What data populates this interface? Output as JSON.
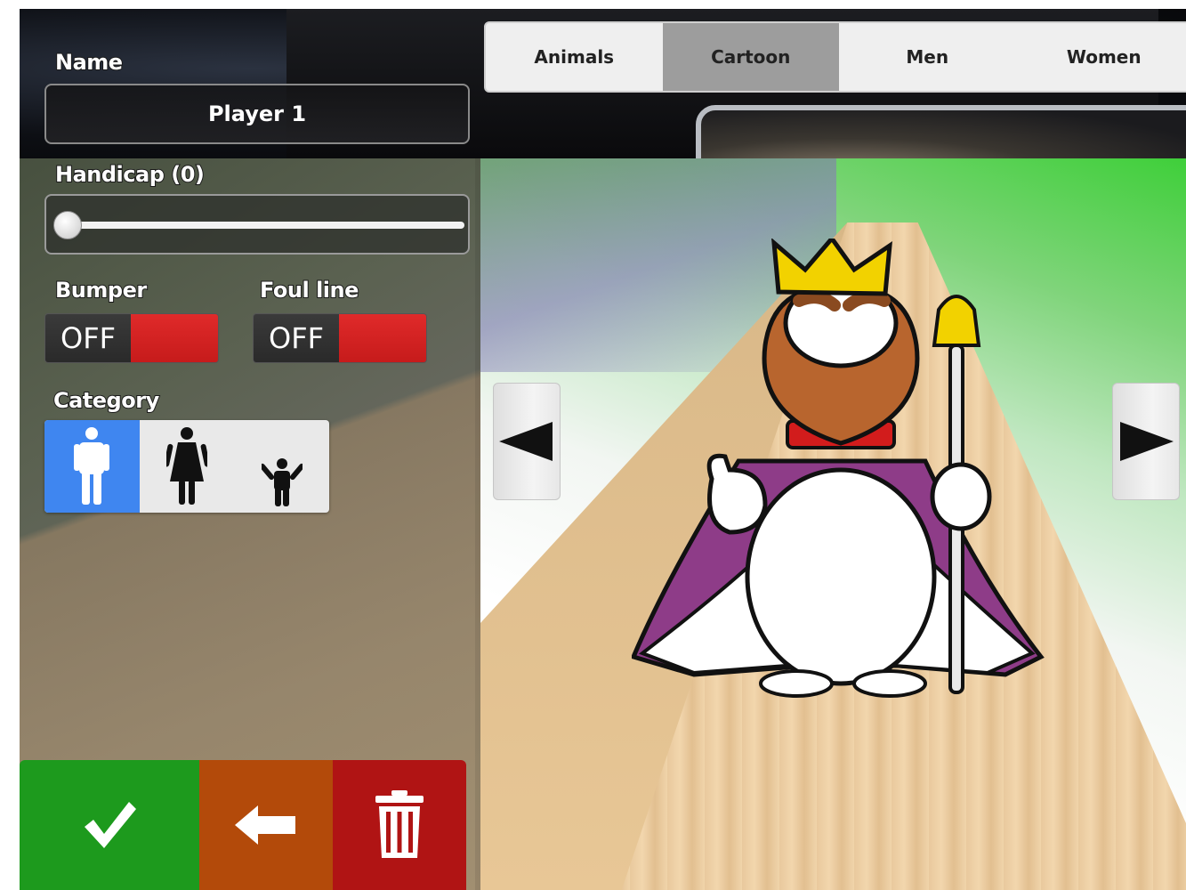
{
  "form": {
    "name_label": "Name",
    "name_value": "Player 1",
    "handicap_label": "Handicap (0)",
    "handicap_value": 0,
    "bumper_label": "Bumper",
    "bumper_state": "OFF",
    "foul_line_label": "Foul line",
    "foul_line_state": "OFF",
    "category_label": "Category",
    "category_options": [
      "man-icon",
      "woman-icon",
      "child-icon"
    ],
    "category_selected": "man-icon"
  },
  "tabs": [
    {
      "label": "Animals",
      "active": false
    },
    {
      "label": "Cartoon",
      "active": true
    },
    {
      "label": "Men",
      "active": false
    },
    {
      "label": "Women",
      "active": false
    }
  ],
  "avatar": {
    "icon": "cartoon-king-avatar"
  },
  "nav": {
    "prev_icon": "arrow-left-icon",
    "next_icon": "arrow-right-icon"
  },
  "actions": [
    {
      "icon": "checkmark-icon",
      "color": "#1d9a1d"
    },
    {
      "icon": "back-arrow-icon",
      "color": "#b34a0a"
    },
    {
      "icon": "trash-icon",
      "color": "#b01414"
    }
  ],
  "colors": {
    "active_tab": "#9d9d9d",
    "active_category": "#3f86f0",
    "toggle_red": "#d42222"
  }
}
